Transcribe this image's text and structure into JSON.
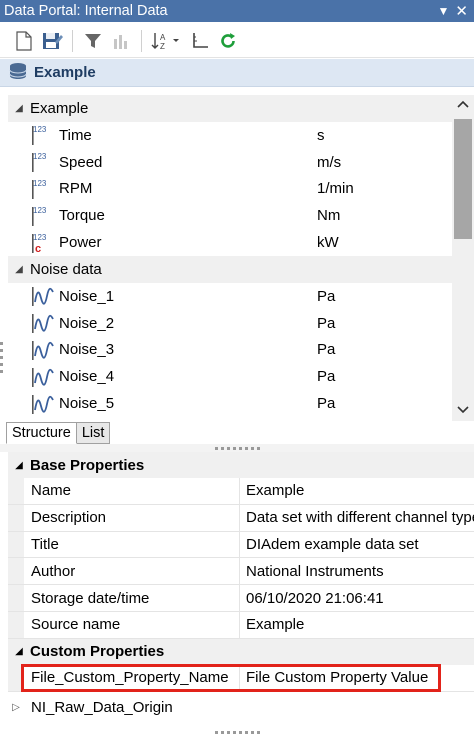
{
  "window": {
    "title": "Data Portal: Internal Data",
    "pin_glyph": "▼",
    "close_glyph": "✕"
  },
  "toolbar": {
    "buttons": [
      "new-icon",
      "save-icon",
      "filter-icon",
      "chart-icon",
      "sort-icon",
      "axis-icon",
      "refresh-icon"
    ]
  },
  "portal": {
    "header": "Example"
  },
  "tree": {
    "groups": [
      {
        "name": "Example",
        "channels": [
          {
            "name": "Time",
            "unit": "s",
            "type": "numeric"
          },
          {
            "name": "Speed",
            "unit": "m/s",
            "type": "numeric"
          },
          {
            "name": "RPM",
            "unit": "1/min",
            "type": "numeric"
          },
          {
            "name": "Torque",
            "unit": "Nm",
            "type": "numeric"
          },
          {
            "name": "Power",
            "unit": "kW",
            "type": "calculated"
          }
        ]
      },
      {
        "name": "Noise data",
        "channels": [
          {
            "name": "Noise_1",
            "unit": "Pa",
            "type": "waveform"
          },
          {
            "name": "Noise_2",
            "unit": "Pa",
            "type": "waveform"
          },
          {
            "name": "Noise_3",
            "unit": "Pa",
            "type": "waveform"
          },
          {
            "name": "Noise_4",
            "unit": "Pa",
            "type": "waveform"
          },
          {
            "name": "Noise_5",
            "unit": "Pa",
            "type": "waveform"
          }
        ]
      }
    ]
  },
  "tabs": {
    "structure": "Structure",
    "list": "List"
  },
  "properties": {
    "base_header": "Base Properties",
    "base": [
      {
        "name": "Name",
        "value": "Example"
      },
      {
        "name": "Description",
        "value": "Data set with different channel types"
      },
      {
        "name": "Title",
        "value": "DIAdem example data set"
      },
      {
        "name": "Author",
        "value": "National Instruments"
      },
      {
        "name": "Storage date/time",
        "value": "06/10/2020 21:06:41"
      },
      {
        "name": "Source name",
        "value": "Example"
      }
    ],
    "custom_header": "Custom Properties",
    "custom": [
      {
        "name": "File_Custom_Property_Name",
        "value": "File Custom Property Value"
      }
    ],
    "collapsed": "NI_Raw_Data_Origin"
  },
  "colors": {
    "titlebar": "#4a72a8",
    "header_bg": "#dde7f3",
    "highlight": "#e2231a"
  }
}
